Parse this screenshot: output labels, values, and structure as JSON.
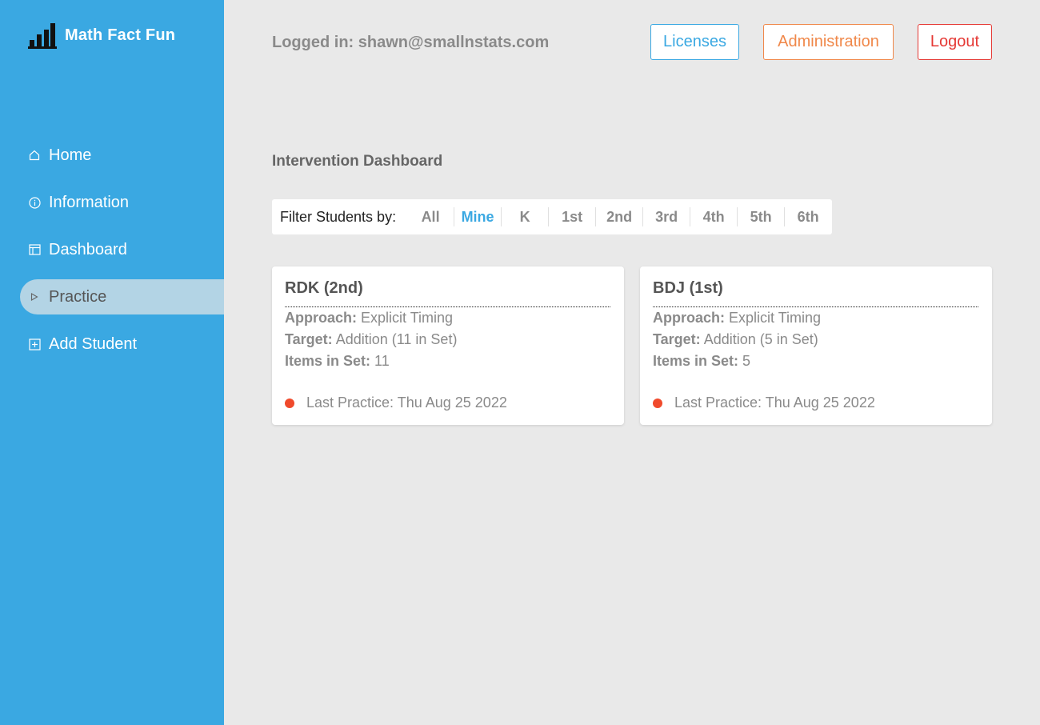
{
  "brand": {
    "name": "Math Fact Fun",
    "icon": "bar-chart-icon"
  },
  "nav": [
    {
      "label": "Home",
      "icon": "home-icon"
    },
    {
      "label": "Information",
      "icon": "info-icon"
    },
    {
      "label": "Dashboard",
      "icon": "dashboard-icon"
    },
    {
      "label": "Practice",
      "icon": "play-icon",
      "active": true
    },
    {
      "label": "Add Student",
      "icon": "plus-square-icon"
    }
  ],
  "header": {
    "logged_in": "Logged in: shawn@smallnstats.com",
    "licenses": "Licenses",
    "administration": "Administration",
    "logout": "Logout"
  },
  "page_title": "Intervention Dashboard",
  "filter": {
    "label": "Filter Students by:",
    "options": [
      "All",
      "Mine",
      "K",
      "1st",
      "2nd",
      "3rd",
      "4th",
      "5th",
      "6th"
    ],
    "selected": "Mine"
  },
  "students": [
    {
      "title": "RDK (2nd)",
      "approach_label": "Approach:",
      "approach": "Explicit Timing",
      "target_label": "Target:",
      "target": "Addition (11 in Set)",
      "items_label": "Items in Set:",
      "items": "11",
      "last_practice": "Last Practice: Thu Aug 25 2022",
      "status_color": "#f04a2c"
    },
    {
      "title": "BDJ (1st)",
      "approach_label": "Approach:",
      "approach": "Explicit Timing",
      "target_label": "Target:",
      "target": "Addition (5 in Set)",
      "items_label": "Items in Set:",
      "items": "5",
      "last_practice": "Last Practice: Thu Aug 25 2022",
      "status_color": "#f04a2c"
    }
  ],
  "colors": {
    "sidebar": "#3aa8e2",
    "accent": "#3aa8e2",
    "admin": "#f0884a",
    "logout": "#e53935"
  }
}
